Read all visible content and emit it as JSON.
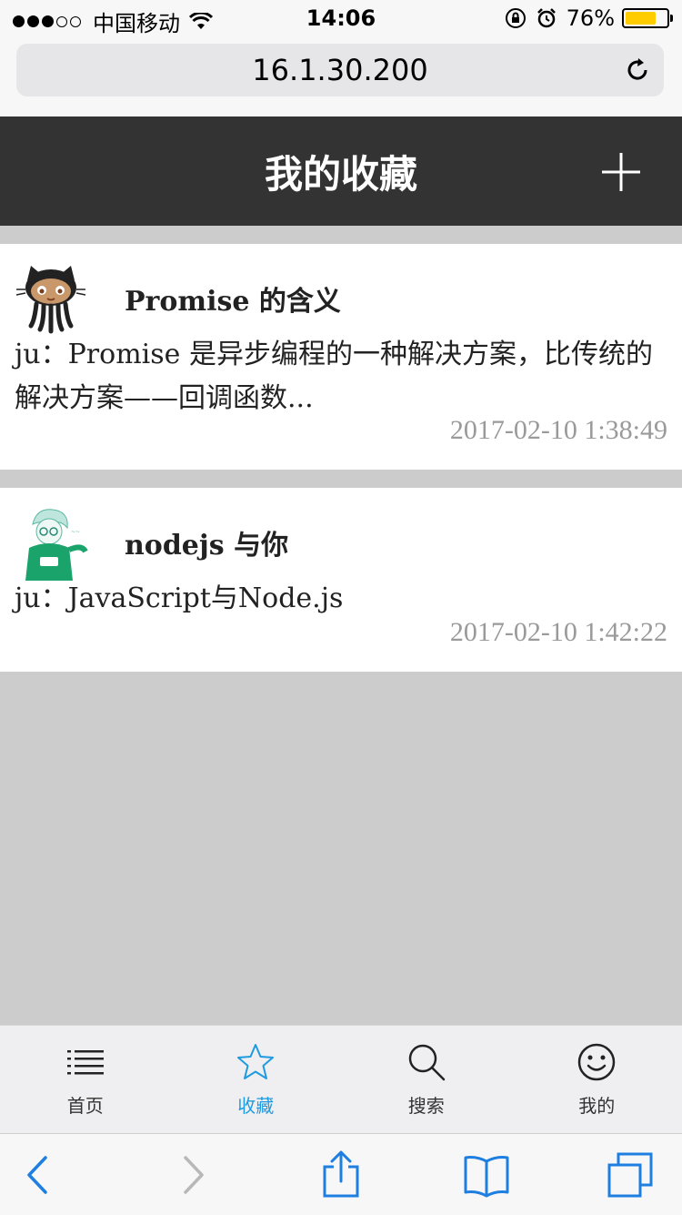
{
  "status_bar": {
    "carrier": "中国移动",
    "time": "14:06",
    "battery_percent": "76%",
    "battery_level": 0.76,
    "signal_bars_filled": 3,
    "signal_bars_total": 5
  },
  "browser": {
    "url": "16.1.30.200"
  },
  "header": {
    "title": "我的收藏",
    "add_icon": "plus-icon"
  },
  "favorites": [
    {
      "avatar_icon": "github-octocat-avatar",
      "title": "Promise 的含义",
      "summary": "ju：Promise 是异步编程的一种解决方案，比传统的解决方案——回调函数...",
      "time": "2017-02-10 1:38:49"
    },
    {
      "avatar_icon": "user-avatar",
      "title": "nodejs 与你",
      "summary": "ju：JavaScript与Node.js",
      "time": "2017-02-10 1:42:22"
    }
  ],
  "tabbar": {
    "items": [
      {
        "label": "首页",
        "icon": "list-icon",
        "active": false
      },
      {
        "label": "收藏",
        "icon": "star-icon",
        "active": true
      },
      {
        "label": "搜索",
        "icon": "search-icon",
        "active": false
      },
      {
        "label": "我的",
        "icon": "smiley-icon",
        "active": false
      }
    ],
    "active_color": "#1e9be0"
  },
  "toolbar": {
    "icons": [
      "back-icon",
      "forward-icon",
      "share-icon",
      "bookmarks-icon",
      "tabs-icon"
    ],
    "accent_color": "#1e7fe0"
  }
}
